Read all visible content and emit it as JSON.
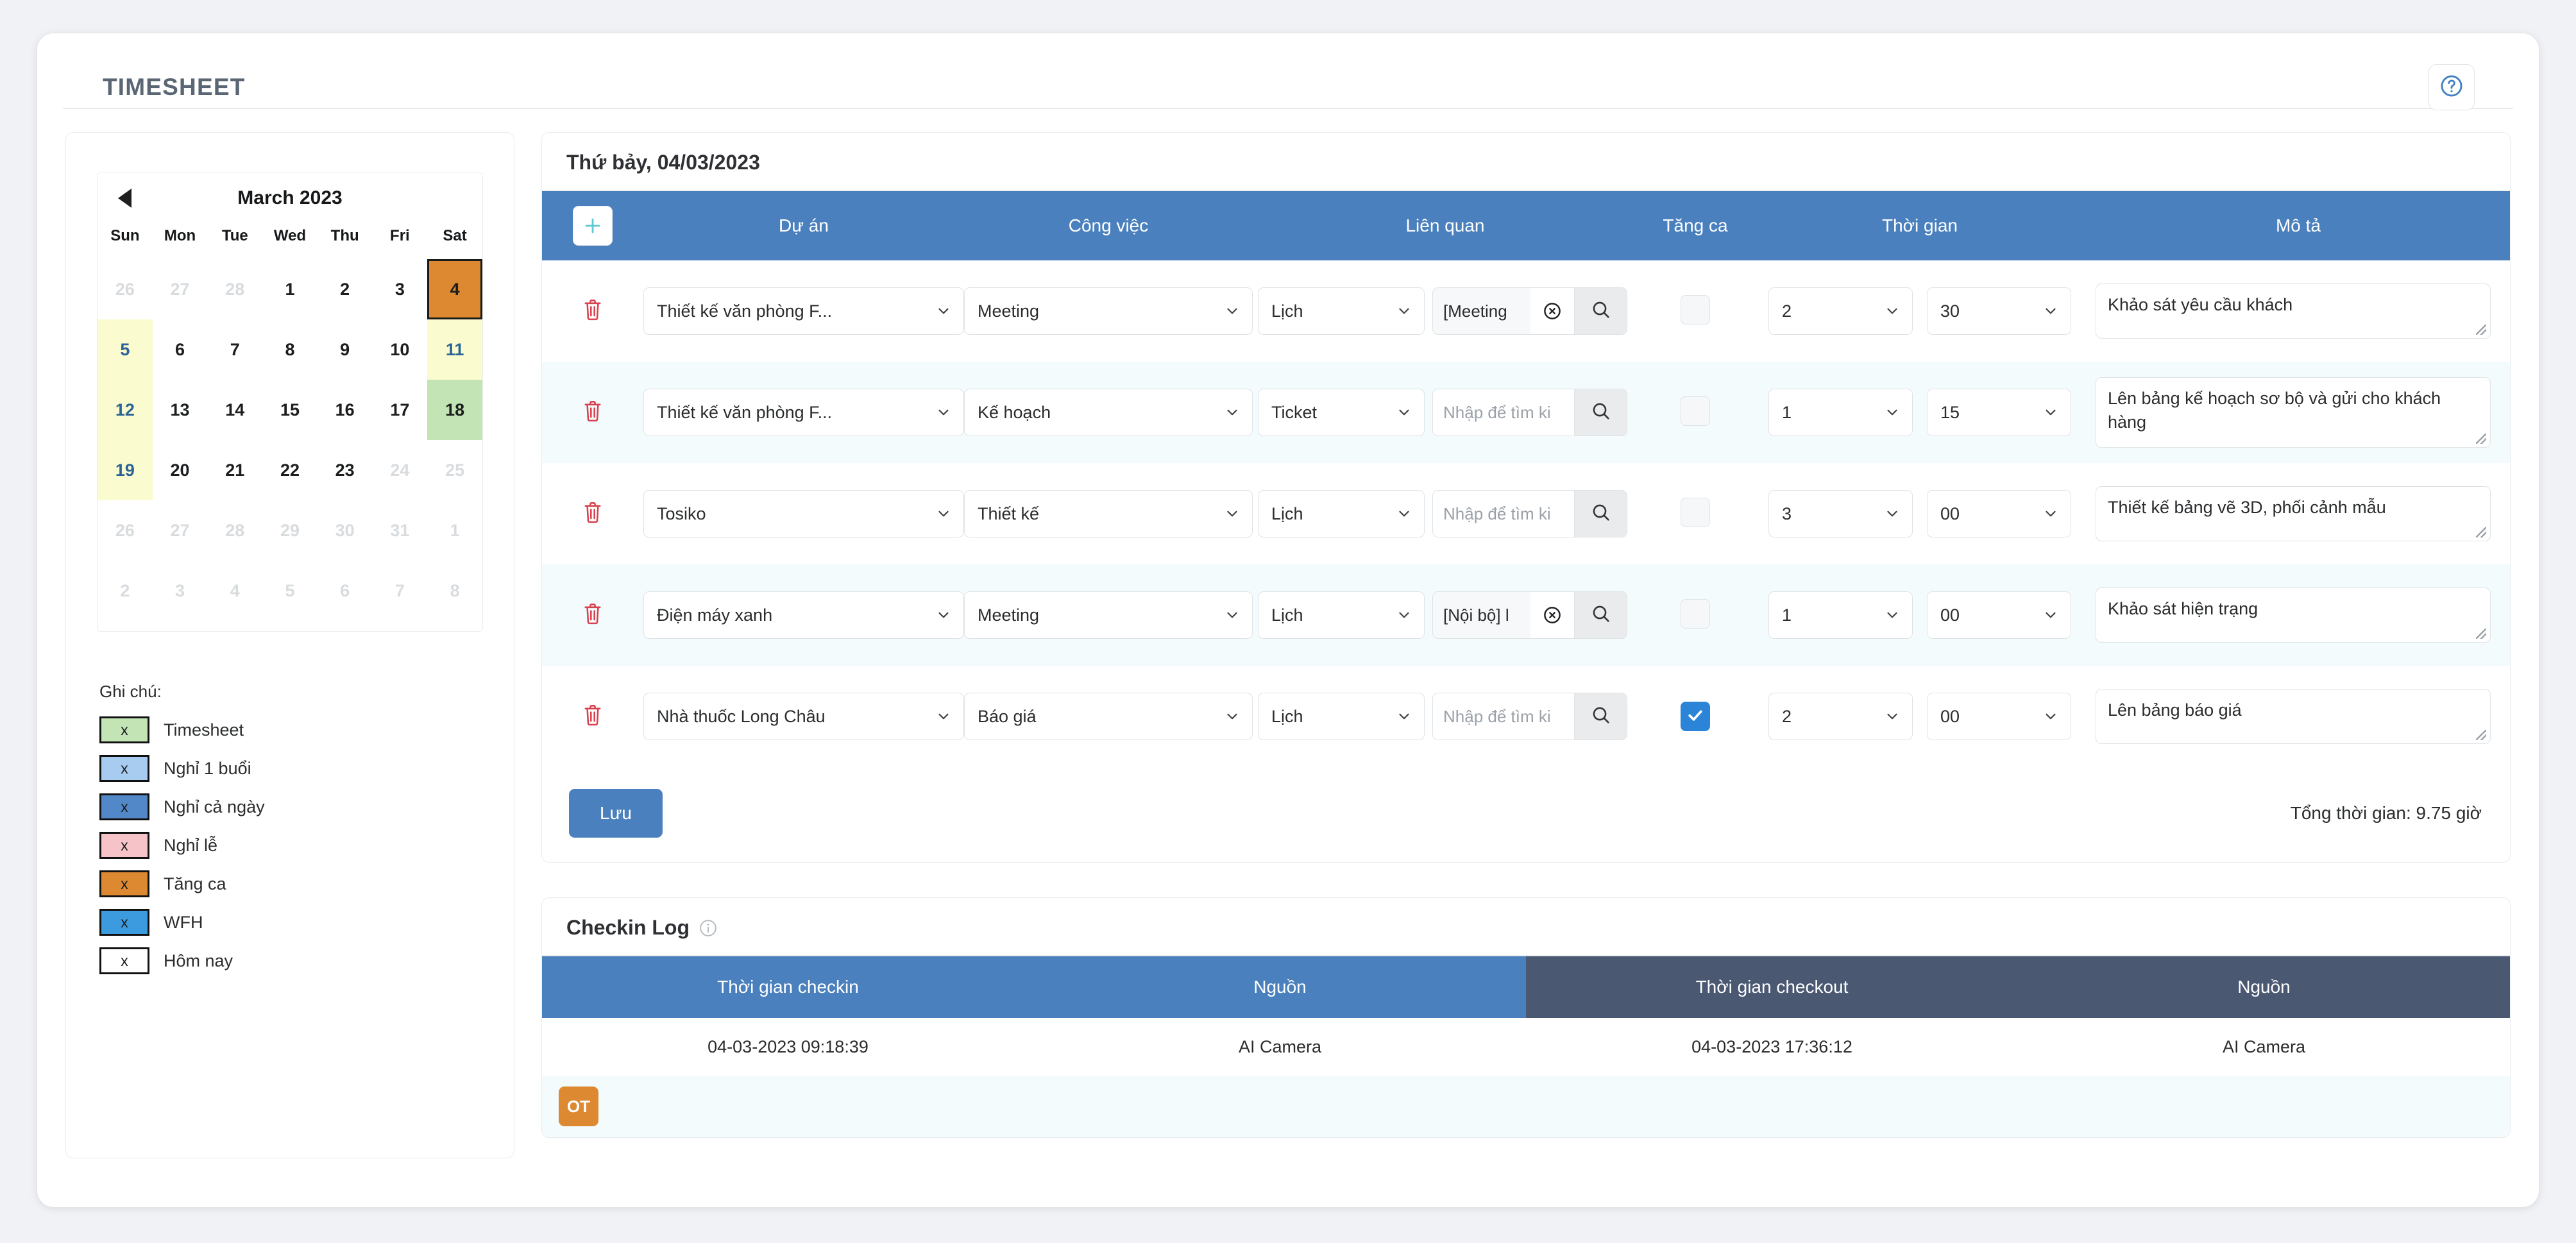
{
  "header": {
    "title": "TIMESHEET",
    "help_icon": "question-circle-icon"
  },
  "calendar": {
    "month_label": "March 2023",
    "prev_icon": "triangle-left-icon",
    "weekdays": [
      "Sun",
      "Mon",
      "Tue",
      "Wed",
      "Thu",
      "Fri",
      "Sat"
    ],
    "weeks": [
      [
        {
          "day": "26",
          "state": "muted"
        },
        {
          "day": "27",
          "state": "muted"
        },
        {
          "day": "28",
          "state": "muted"
        },
        {
          "day": "1",
          "state": "normal"
        },
        {
          "day": "2",
          "state": "normal"
        },
        {
          "day": "3",
          "state": "normal"
        },
        {
          "day": "4",
          "state": "overtime-selected"
        }
      ],
      [
        {
          "day": "5",
          "state": "sunday-week"
        },
        {
          "day": "6",
          "state": "normal"
        },
        {
          "day": "7",
          "state": "normal"
        },
        {
          "day": "8",
          "state": "normal"
        },
        {
          "day": "9",
          "state": "normal"
        },
        {
          "day": "10",
          "state": "normal"
        },
        {
          "day": "11",
          "state": "saturday-week"
        }
      ],
      [
        {
          "day": "12",
          "state": "sunday-week"
        },
        {
          "day": "13",
          "state": "normal"
        },
        {
          "day": "14",
          "state": "normal"
        },
        {
          "day": "15",
          "state": "normal"
        },
        {
          "day": "16",
          "state": "normal"
        },
        {
          "day": "17",
          "state": "normal"
        },
        {
          "day": "18",
          "state": "timesheet"
        }
      ],
      [
        {
          "day": "19",
          "state": "sunday-week"
        },
        {
          "day": "20",
          "state": "normal"
        },
        {
          "day": "21",
          "state": "normal"
        },
        {
          "day": "22",
          "state": "normal"
        },
        {
          "day": "23",
          "state": "normal"
        },
        {
          "day": "24",
          "state": "muted"
        },
        {
          "day": "25",
          "state": "muted"
        }
      ],
      [
        {
          "day": "26",
          "state": "muted"
        },
        {
          "day": "27",
          "state": "muted"
        },
        {
          "day": "28",
          "state": "muted"
        },
        {
          "day": "29",
          "state": "muted"
        },
        {
          "day": "30",
          "state": "muted"
        },
        {
          "day": "31",
          "state": "muted"
        },
        {
          "day": "1",
          "state": "muted"
        }
      ],
      [
        {
          "day": "2",
          "state": "muted"
        },
        {
          "day": "3",
          "state": "muted"
        },
        {
          "day": "4",
          "state": "muted"
        },
        {
          "day": "5",
          "state": "muted"
        },
        {
          "day": "6",
          "state": "muted"
        },
        {
          "day": "7",
          "state": "muted"
        },
        {
          "day": "8",
          "state": "muted"
        }
      ]
    ]
  },
  "legend": {
    "title": "Ghi chú:",
    "mark": "x",
    "items": [
      {
        "label": "Timesheet",
        "color": "#c3e5b5"
      },
      {
        "label": "Nghỉ 1 buổi",
        "color": "#a8cbf0"
      },
      {
        "label": "Nghỉ cả ngày",
        "color": "#5388c8"
      },
      {
        "label": "Nghỉ lễ",
        "color": "#f6c3c9"
      },
      {
        "label": "Tăng ca",
        "color": "#dd8932"
      },
      {
        "label": "WFH",
        "color": "#3c9ade"
      },
      {
        "label": "Hôm nay",
        "color": "#ffffff"
      }
    ]
  },
  "timesheet": {
    "date_title": "Thứ bảy, 04/03/2023",
    "add_row_icon": "plus-icon",
    "columns": {
      "project": "Dự án",
      "work": "Công việc",
      "relation": "Liên quan",
      "overtime": "Tăng ca",
      "time": "Thời gian",
      "description": "Mô tả"
    },
    "search_placeholder": "Nhập để tìm ki",
    "delete_icon": "trash-icon",
    "search_icon": "magnifier-icon",
    "clear_icon": "circle-x-icon",
    "chevron_icon": "chevron-down-icon",
    "rows": [
      {
        "project": "Thiết kế văn phòng F...",
        "work": "Meeting",
        "relation_type": "Lịch",
        "relation_value": "[Meeting",
        "relation_filled": true,
        "overtime": false,
        "hours": "2",
        "minutes": "30",
        "description": "Khảo sát yêu cầu khách"
      },
      {
        "project": "Thiết kế văn phòng F...",
        "work": "Kế hoạch",
        "relation_type": "Ticket",
        "relation_value": "",
        "relation_filled": false,
        "overtime": false,
        "hours": "1",
        "minutes": "15",
        "description": "Lên bảng kế hoạch sơ bộ và gửi cho khách hàng"
      },
      {
        "project": "Tosiko",
        "work": "Thiết kế",
        "relation_type": "Lịch",
        "relation_value": "",
        "relation_filled": false,
        "overtime": false,
        "hours": "3",
        "minutes": "00",
        "description": "Thiết kế bảng vẽ 3D, phối cảnh mẫu"
      },
      {
        "project": "Điện máy xanh",
        "work": "Meeting",
        "relation_type": "Lịch",
        "relation_value": "[Nội bộ] l",
        "relation_filled": true,
        "overtime": false,
        "hours": "1",
        "minutes": "00",
        "description": "Khảo sát hiện trạng"
      },
      {
        "project": "Nhà thuốc Long Châu",
        "work": "Báo giá",
        "relation_type": "Lịch",
        "relation_value": "",
        "relation_filled": false,
        "overtime": true,
        "hours": "2",
        "minutes": "00",
        "description": "Lên bảng báo giá"
      }
    ],
    "save_label": "Lưu",
    "total_time": "Tổng thời gian: 9.75 giờ"
  },
  "checkin_log": {
    "title": "Checkin Log",
    "info_icon": "info-circle-icon",
    "columns": {
      "checkin_time": "Thời gian checkin",
      "source_in": "Nguồn",
      "checkout_time": "Thời gian checkout",
      "source_out": "Nguồn"
    },
    "rows": [
      {
        "checkin_time": "04-03-2023 09:18:39",
        "source_in": "AI Camera",
        "checkout_time": "04-03-2023 17:36:12",
        "source_out": "AI Camera"
      }
    ],
    "ot_badge": "OT"
  },
  "colors": {
    "header_blue": "#4a80bd",
    "header_dark": "#4a5872",
    "orange": "#dd8932",
    "green": "#c3e5b5",
    "yellow": "#fbfbd0",
    "checkbox_blue": "#2b84d8",
    "trash_red": "#d9424f"
  }
}
